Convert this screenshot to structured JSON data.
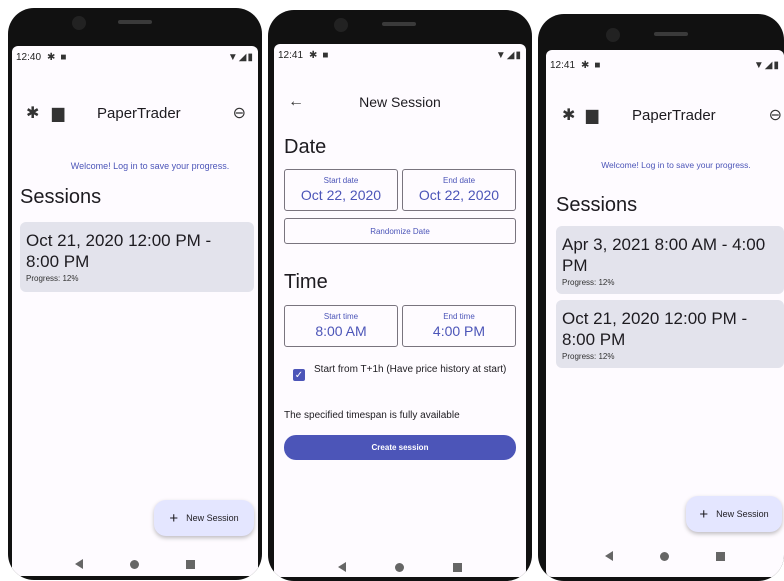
{
  "phone1": {
    "status": {
      "time": "12:40",
      "icon1": "gear-icon",
      "icon2": "square-icon",
      "right": "▼◢▮"
    },
    "topbar": {
      "title": "PaperTrader"
    },
    "welcome": "Welcome! Log in to save your progress.",
    "heading": "Sessions",
    "sessions": [
      {
        "title": "Oct 21, 2020 12:00 PM - 8:00 PM",
        "progress": "Progress: 12%"
      }
    ],
    "fab": {
      "plus": "+",
      "label": "New Session"
    }
  },
  "phone2": {
    "status": {
      "time": "12:41",
      "right": "▼◢▮"
    },
    "topbar": {
      "back": "←",
      "title": "New Session"
    },
    "date": {
      "heading": "Date",
      "start_label": "Start date",
      "start_value": "Oct 22, 2020",
      "end_label": "End date",
      "end_value": "Oct 22, 2020",
      "randomize": "Randomize Date"
    },
    "time": {
      "heading": "Time",
      "start_label": "Start time",
      "start_value": "8:00 AM",
      "end_label": "End time",
      "end_value": "4:00 PM"
    },
    "checkbox": {
      "mark": "✓",
      "label": "Start from T+1h (Have price history at start)"
    },
    "availability": "The specified timespan is fully available",
    "create": "Create session"
  },
  "phone3": {
    "status": {
      "time": "12:41",
      "right": "▼◢▮"
    },
    "topbar": {
      "title": "PaperTrader"
    },
    "welcome": "Welcome! Log in to save your progress.",
    "heading": "Sessions",
    "sessions": [
      {
        "title": "Apr 3, 2021 8:00 AM - 4:00 PM",
        "progress": "Progress: 12%"
      },
      {
        "title": "Oct 21, 2020 12:00 PM - 8:00 PM",
        "progress": "Progress: 12%"
      }
    ],
    "fab": {
      "plus": "+",
      "label": "New Session"
    }
  },
  "colors": {
    "accent": "#4c55b8",
    "card": "#e3e3ec",
    "fab": "#e4e6ff",
    "background": "#fefbff"
  }
}
